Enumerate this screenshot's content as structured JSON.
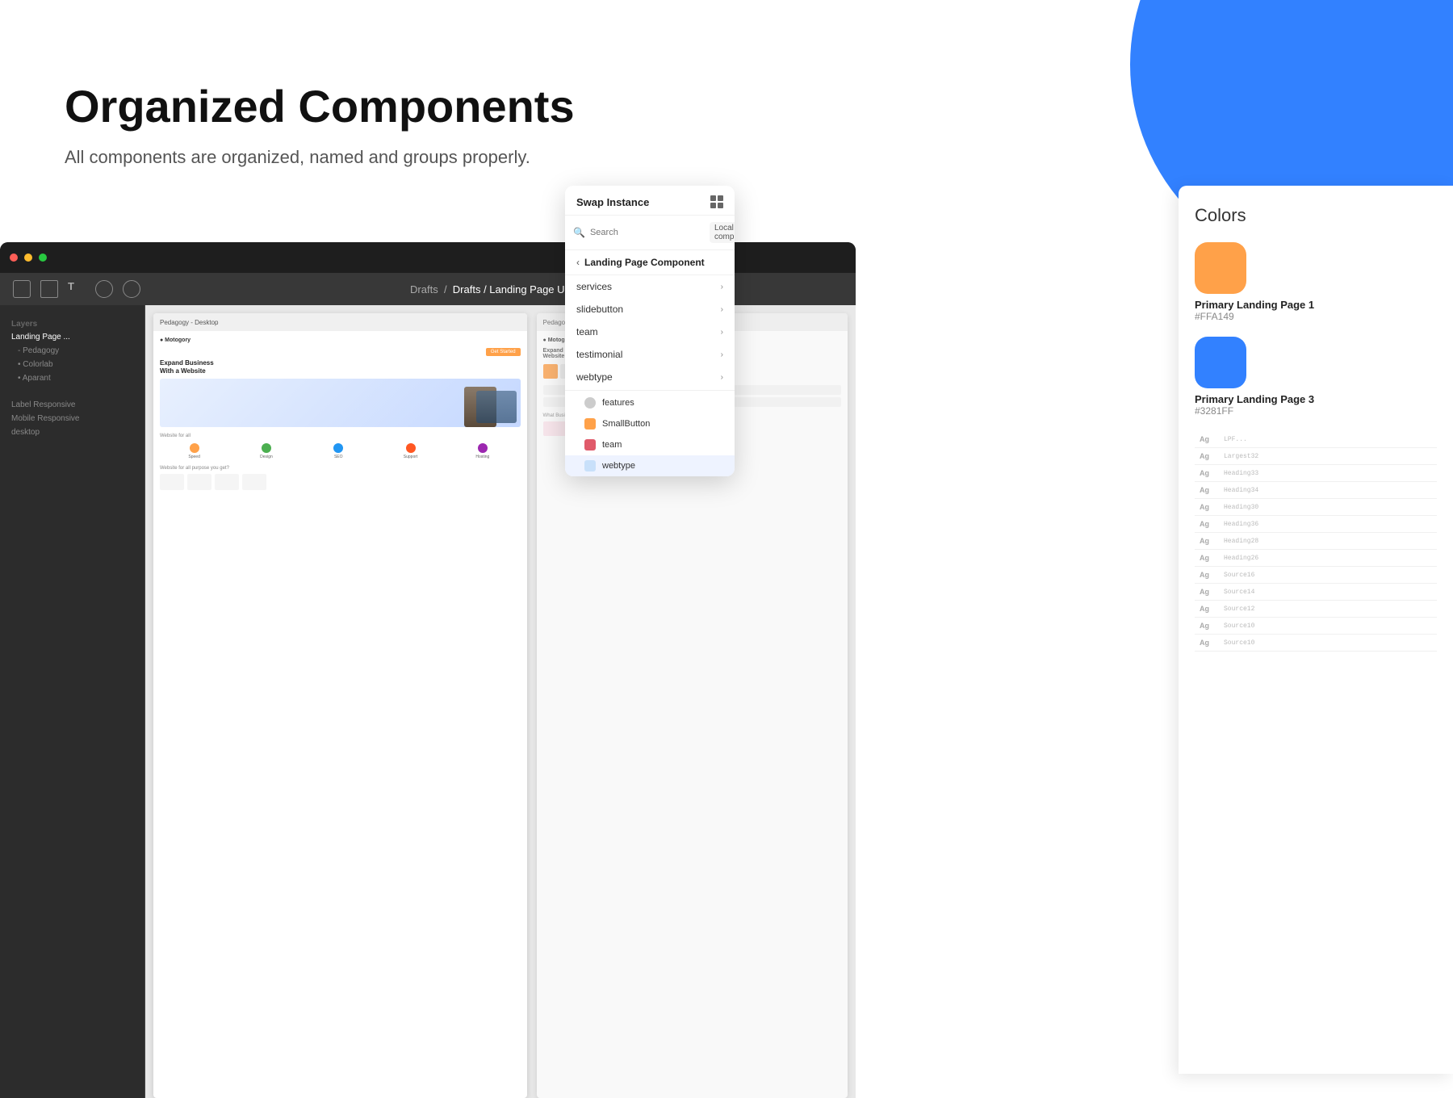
{
  "hero": {
    "title": "Organized Components",
    "subtitle": "All components are organized, named and groups properly."
  },
  "editor": {
    "toolbar_path": "Drafts / Landing Page UI Kit",
    "sidebar_items": [
      {
        "label": "Landing Page ..."
      },
      {
        "label": "- Pedagogy"
      },
      {
        "label": "• Colorlab"
      },
      {
        "label": "• Aparant"
      },
      {
        "label": "Label Responsive"
      },
      {
        "label": "Mobile Responsive"
      },
      {
        "label": "desktop"
      }
    ],
    "canvas_frame_label": "Pedagogy - Desktop"
  },
  "swap_panel": {
    "title": "Swap Instance",
    "search_placeholder": "Search",
    "dropdown_label": "Local comp...",
    "back_label": "Landing Page Component",
    "menu_items": [
      {
        "label": "services",
        "has_chevron": true
      },
      {
        "label": "slidebutton",
        "has_chevron": true
      },
      {
        "label": "team",
        "has_chevron": true
      },
      {
        "label": "testimonial",
        "has_chevron": true
      },
      {
        "label": "webtype",
        "has_chevron": true
      }
    ],
    "sub_items": [
      {
        "label": "features",
        "icon_color": "#cccccc",
        "icon_shape": "dot"
      },
      {
        "label": "SmallButton",
        "icon_color": "#FFA149",
        "icon_shape": "rect"
      },
      {
        "label": "team",
        "icon_color": "#e05a6a",
        "icon_shape": "rect"
      },
      {
        "label": "webtype",
        "icon_color": "#c8e0fa",
        "icon_shape": "rect",
        "highlighted": true
      }
    ]
  },
  "colors_panel": {
    "title": "Colors",
    "swatches": [
      {
        "color": "#FFA149",
        "name": "Primary Landing Page 1",
        "hex": "#FFA149"
      },
      {
        "color": "#3281FF",
        "name": "Primary Landing Page 3",
        "hex": "#3281FF"
      }
    ],
    "ag_rows": [
      {
        "label": "Ag",
        "value": "LPF..."
      },
      {
        "label": "Ag",
        "value": "Largest32"
      },
      {
        "label": "Ag",
        "value": "Heading33"
      },
      {
        "label": "Ag",
        "value": "Heading34"
      },
      {
        "label": "Ag",
        "value": "Heading30"
      },
      {
        "label": "Ag",
        "value": "Heading36"
      },
      {
        "label": "Ag",
        "value": "Heading28"
      },
      {
        "label": "Ag",
        "value": "Heading26"
      },
      {
        "label": "Ag",
        "value": "Source16"
      },
      {
        "label": "Ag",
        "value": "Source14"
      },
      {
        "label": "Ag",
        "value": "Source12"
      },
      {
        "label": "Ag",
        "value": "Source10"
      },
      {
        "label": "Ag",
        "value": "Source10"
      }
    ]
  },
  "mock_canvas": {
    "logo_text": "● Motogory",
    "hero_title": "Expand Business With a Website",
    "btn_label": "Get Started",
    "features": [
      {
        "color": "#FFA149"
      },
      {
        "color": "#4CAF50"
      },
      {
        "color": "#2196F3"
      },
      {
        "color": "#FF5722"
      },
      {
        "color": "#9C27B0"
      }
    ]
  }
}
